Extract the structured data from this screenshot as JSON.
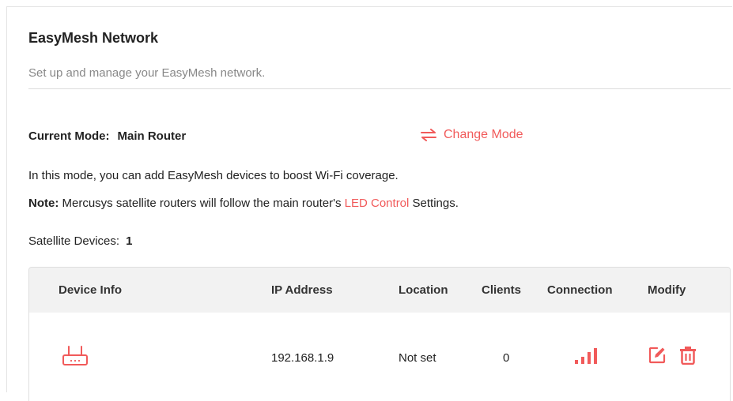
{
  "header": {
    "title": "EasyMesh Network",
    "subtitle": "Set up and manage your EasyMesh network."
  },
  "mode": {
    "label": "Current Mode:",
    "value": "Main Router",
    "change_label": "Change Mode"
  },
  "description": "In this mode, you can add EasyMesh devices to boost Wi-Fi coverage.",
  "note": {
    "prefix": "Note:",
    "text_before": " Mercusys satellite routers will follow the main router's ",
    "link": "LED Control",
    "text_after": " Settings."
  },
  "satellite": {
    "label": "Satellite Devices:",
    "count": "1"
  },
  "table": {
    "headers": [
      "Device Info",
      "IP Address",
      "Location",
      "Clients",
      "Connection",
      "Modify"
    ],
    "rows": [
      {
        "device_icon": "router-icon",
        "ip": "192.168.1.9",
        "location": "Not set",
        "clients": "0",
        "connection_icon": "signal-strength-icon",
        "modify_icons": [
          "edit-icon",
          "trash-icon"
        ]
      }
    ]
  },
  "colors": {
    "accent": "#f15a5a",
    "header_bg": "#f2f2f2",
    "border": "#dedede"
  }
}
